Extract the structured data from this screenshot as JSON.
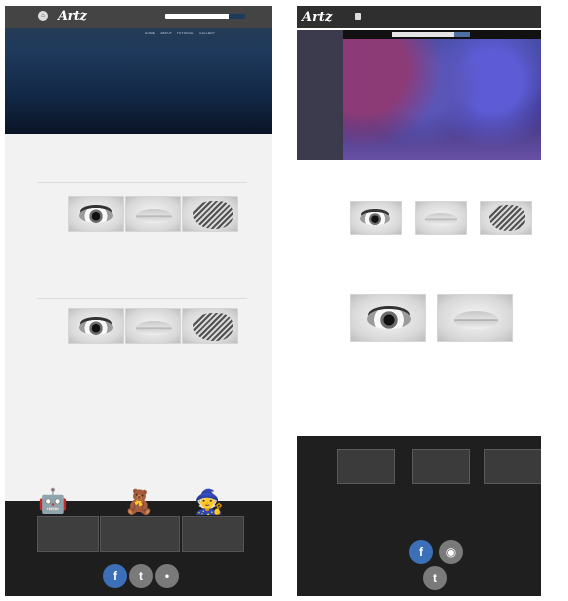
{
  "left": {
    "nav": [
      "HOME",
      "ABOUT",
      "TUTORIAL",
      "GALLERY"
    ]
  },
  "right": {
    "sidebar_items": [
      "",
      "",
      "",
      "",
      "",
      ""
    ]
  },
  "colors": {
    "left_header": "#1f3a5c",
    "left_footer": "#1e1e1e",
    "right_header": "#2f2f2f",
    "right_footer": "#1f1f1f",
    "social_blue": "#3b6fb7",
    "social_gray": "#7a7a7a"
  },
  "icons": {
    "left_logo": "home-icon",
    "facebook": "facebook-icon",
    "twitter": "twitter-icon",
    "other": "social-icon",
    "mascot1": "mascot-icon",
    "mascot2": "mascot-icon",
    "mascot3": "mascot-icon"
  }
}
